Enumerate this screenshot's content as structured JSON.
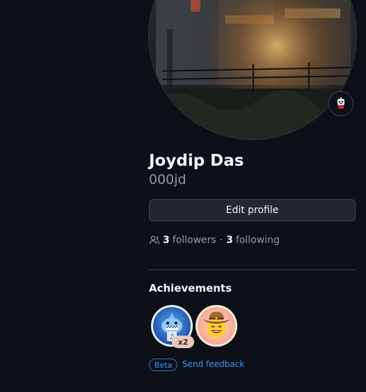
{
  "profile": {
    "name": "Joydip Das",
    "login": "000jd",
    "edit_label": "Edit profile",
    "followers_count": "3",
    "followers_label": "followers",
    "separator": "·",
    "following_count": "3",
    "following_label": "following"
  },
  "achievements": {
    "title": "Achievements",
    "badges": [
      {
        "name": "shark-badge",
        "tier": "x2"
      },
      {
        "name": "cowboy-badge"
      }
    ],
    "beta_label": "Beta",
    "feedback_label": "Send feedback"
  },
  "colors": {
    "background": "#0d1117",
    "accent": "#4493f8",
    "text": "#f0f6fc",
    "muted": "#9198a1"
  },
  "icons": [
    "people-icon",
    "status-emoji-icon",
    "shark-icon",
    "cowboy-icon"
  ]
}
